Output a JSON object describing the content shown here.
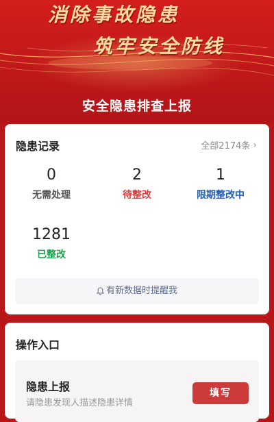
{
  "banner": {
    "slogan_line1": "消除事故隐患",
    "slogan_line2": "筑牢安全防线"
  },
  "page": {
    "title": "安全隐患排查上报"
  },
  "records": {
    "heading": "隐患记录",
    "all_link": "全部2174条",
    "stats": [
      {
        "value": "0",
        "label": "无需处理",
        "color": "#555555"
      },
      {
        "value": "2",
        "label": "待整改",
        "color": "#e0393b"
      },
      {
        "value": "1",
        "label": "限期整改中",
        "color": "#1f5fb8"
      },
      {
        "value": "1281",
        "label": "已整改",
        "color": "#1aa34a"
      }
    ],
    "notify_label": "有新数据时提醒我"
  },
  "operations": {
    "heading": "操作入口",
    "items": [
      {
        "title": "隐患上报",
        "desc": "请隐患发现人描述隐患详情",
        "button": "填写"
      }
    ]
  },
  "colors": {
    "brand_red": "#cc3a3a",
    "background_red": "#b9161a"
  }
}
